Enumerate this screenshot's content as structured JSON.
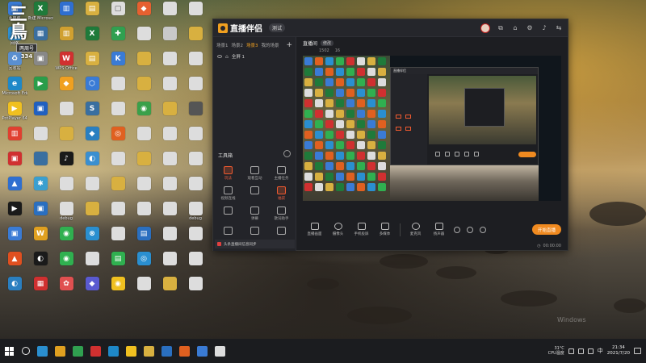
{
  "desktop_badge": {
    "big": "三鳥",
    "tag": "两周号",
    "num": "334"
  },
  "desktop_icons": [
    {
      "label": "此电脑",
      "color": "#3a7bd5",
      "g": "▣"
    },
    {
      "label": "新建 Microsoft",
      "color": "#1f7a3a",
      "g": "X"
    },
    {
      "label": "",
      "color": "#2f6fd0",
      "g": "▥"
    },
    {
      "label": "",
      "color": "#d8b040",
      "g": "▤"
    },
    {
      "label": "",
      "color": "#dddddd",
      "g": "▢"
    },
    {
      "label": "",
      "color": "#e66030",
      "g": "◆"
    },
    {
      "label": "",
      "color": "#dddddd",
      "g": ""
    },
    {
      "label": "",
      "color": "#dddddd",
      "g": ""
    },
    {
      "label": "网络",
      "color": "#2f8fd0",
      "g": "◉"
    },
    {
      "label": "",
      "color": "#3a6fa0",
      "g": "▦"
    },
    {
      "label": "",
      "color": "#d0a030",
      "g": "▥"
    },
    {
      "label": "",
      "color": "#1f7a3a",
      "g": "X"
    },
    {
      "label": "",
      "color": "#30a050",
      "g": "✚"
    },
    {
      "label": "",
      "color": "#dddddd",
      "g": ""
    },
    {
      "label": "",
      "color": "#c9c9c9",
      "g": ""
    },
    {
      "label": "",
      "color": "#d8b040",
      "g": ""
    },
    {
      "label": "回收站",
      "color": "#5a8fd0",
      "g": "♻"
    },
    {
      "label": "",
      "color": "#888888",
      "g": "▣"
    },
    {
      "label": "WPS Office",
      "color": "#d03030",
      "g": "W"
    },
    {
      "label": "",
      "color": "#d8b040",
      "g": "▤"
    },
    {
      "label": "",
      "color": "#3a7bd5",
      "g": "K"
    },
    {
      "label": "",
      "color": "#d8b040",
      "g": ""
    },
    {
      "label": "",
      "color": "#dddddd",
      "g": ""
    },
    {
      "label": "",
      "color": "#dddddd",
      "g": ""
    },
    {
      "label": "Microsoft Edge",
      "color": "#1e88c8",
      "g": "e"
    },
    {
      "label": "",
      "color": "#2a9d4a",
      "g": "▶"
    },
    {
      "label": "",
      "color": "#f0a020",
      "g": "◆"
    },
    {
      "label": "",
      "color": "#3a7bd5",
      "g": "⬡"
    },
    {
      "label": "",
      "color": "#dddddd",
      "g": ""
    },
    {
      "label": "",
      "color": "#d8b040",
      "g": ""
    },
    {
      "label": "",
      "color": "#dddddd",
      "g": ""
    },
    {
      "label": "",
      "color": "#dddddd",
      "g": ""
    },
    {
      "label": "PotPlayer 64 bit",
      "color": "#f0c020",
      "g": "▶"
    },
    {
      "label": "",
      "color": "#2060c0",
      "g": "▣"
    },
    {
      "label": "",
      "color": "#dddddd",
      "g": ""
    },
    {
      "label": "",
      "color": "#3a6fa0",
      "g": "S"
    },
    {
      "label": "",
      "color": "#dddddd",
      "g": ""
    },
    {
      "label": "",
      "color": "#3aa04a",
      "g": "◉"
    },
    {
      "label": "",
      "color": "#d8b040",
      "g": ""
    },
    {
      "label": "",
      "color": "#555555",
      "g": ""
    },
    {
      "label": "",
      "color": "#e04030",
      "g": "▥"
    },
    {
      "label": "",
      "color": "#dddddd",
      "g": ""
    },
    {
      "label": "",
      "color": "#d8b040",
      "g": ""
    },
    {
      "label": "",
      "color": "#2a7fc0",
      "g": "◆"
    },
    {
      "label": "",
      "color": "#e06020",
      "g": "◎"
    },
    {
      "label": "",
      "color": "#dddddd",
      "g": ""
    },
    {
      "label": "",
      "color": "#dddddd",
      "g": ""
    },
    {
      "label": "",
      "color": "#dddddd",
      "g": ""
    },
    {
      "label": "",
      "color": "#d03030",
      "g": "▣"
    },
    {
      "label": "",
      "color": "#3a6fa0",
      "g": ""
    },
    {
      "label": "",
      "color": "#1a1a1a",
      "g": "♪"
    },
    {
      "label": "",
      "color": "#3a8fd0",
      "g": "◐"
    },
    {
      "label": "",
      "color": "#dddddd",
      "g": ""
    },
    {
      "label": "",
      "color": "#d8b040",
      "g": ""
    },
    {
      "label": "",
      "color": "#dddddd",
      "g": ""
    },
    {
      "label": "",
      "color": "#dddddd",
      "g": ""
    },
    {
      "label": "",
      "color": "#2f6fd0",
      "g": "▲"
    },
    {
      "label": "",
      "color": "#3a9fd0",
      "g": "✱"
    },
    {
      "label": "",
      "color": "#dddddd",
      "g": ""
    },
    {
      "label": "",
      "color": "#dddddd",
      "g": ""
    },
    {
      "label": "",
      "color": "#d8b040",
      "g": ""
    },
    {
      "label": "",
      "color": "#dddddd",
      "g": ""
    },
    {
      "label": "",
      "color": "#dddddd",
      "g": ""
    },
    {
      "label": "",
      "color": "#dddddd",
      "g": ""
    },
    {
      "label": "",
      "color": "#1a1a1a",
      "g": "▶"
    },
    {
      "label": "",
      "color": "#2a6fc0",
      "g": "▣"
    },
    {
      "label": "debug",
      "color": "#dddddd",
      "g": ""
    },
    {
      "label": "",
      "color": "#d8b040",
      "g": ""
    },
    {
      "label": "",
      "color": "#dddddd",
      "g": ""
    },
    {
      "label": "",
      "color": "#dddddd",
      "g": ""
    },
    {
      "label": "",
      "color": "#dddddd",
      "g": ""
    },
    {
      "label": "debug",
      "color": "#dddddd",
      "g": ""
    },
    {
      "label": "",
      "color": "#3a7bd5",
      "g": "▣"
    },
    {
      "label": "",
      "color": "#e0a020",
      "g": "W"
    },
    {
      "label": "",
      "color": "#30b050",
      "g": "◉"
    },
    {
      "label": "",
      "color": "#2a8fd0",
      "g": "⊗"
    },
    {
      "label": "",
      "color": "#dddddd",
      "g": ""
    },
    {
      "label": "",
      "color": "#2a6fc0",
      "g": "▤"
    },
    {
      "label": "",
      "color": "#dddddd",
      "g": ""
    },
    {
      "label": "",
      "color": "#dddddd",
      "g": ""
    },
    {
      "label": "",
      "color": "#e05020",
      "g": "▲"
    },
    {
      "label": "",
      "color": "#1a1a1a",
      "g": "◐"
    },
    {
      "label": "",
      "color": "#30b050",
      "g": "◉"
    },
    {
      "label": "",
      "color": "#dddddd",
      "g": ""
    },
    {
      "label": "",
      "color": "#30b050",
      "g": "▤"
    },
    {
      "label": "",
      "color": "#2a8fd0",
      "g": "◎"
    },
    {
      "label": "",
      "color": "#dddddd",
      "g": ""
    },
    {
      "label": "",
      "color": "#dddddd",
      "g": ""
    },
    {
      "label": "",
      "color": "#2a7fc0",
      "g": "◐"
    },
    {
      "label": "",
      "color": "#d03030",
      "g": "▦"
    },
    {
      "label": "",
      "color": "#e05050",
      "g": "✿"
    },
    {
      "label": "",
      "color": "#5a5ad0",
      "g": "◆"
    },
    {
      "label": "",
      "color": "#f0c020",
      "g": "◉"
    },
    {
      "label": "",
      "color": "#dddddd",
      "g": ""
    },
    {
      "label": "",
      "color": "#d8b040",
      "g": ""
    },
    {
      "label": "",
      "color": "#dddddd",
      "g": ""
    }
  ],
  "app": {
    "brand": "直播伴侣",
    "version": "测试",
    "tabs": [
      "场景1",
      "场景2",
      "场景3",
      "我的场景"
    ],
    "active_tab_index": 2,
    "scene_item": "全屏 1",
    "toolbox_title": "工具箱",
    "tools": [
      {
        "label": "玩法",
        "hot": true
      },
      {
        "label": "观看互动",
        "hot": false
      },
      {
        "label": "主播任务",
        "hot": false
      },
      {
        "label": "视频连线",
        "hot": false
      },
      {
        "label": "",
        "hot": false
      },
      {
        "label": "福袋",
        "hot": true
      },
      {
        "label": "",
        "hot": false
      },
      {
        "label": "弹幕",
        "hot": false
      },
      {
        "label": "歌词助手",
        "hot": false
      },
      {
        "label": "",
        "hot": false
      },
      {
        "label": "",
        "hot": false
      },
      {
        "label": "",
        "hot": false
      }
    ],
    "bottom_notice": "头条直播间信息同步",
    "room_title": "直播间",
    "room_edit": "修改",
    "room_meta": {
      "category": "",
      "id": "",
      "fans": "1502",
      "viewers": "16"
    },
    "controls": [
      {
        "label": "直播画面",
        "round": false
      },
      {
        "label": "摄像头",
        "round": true
      },
      {
        "label": "手机投屏",
        "round": false
      },
      {
        "label": "多媒体",
        "round": false
      },
      {
        "label": "麦克风",
        "round": true
      },
      {
        "label": "扬声器",
        "round": false
      }
    ],
    "go_live": "开始直播",
    "status_time": "00:00:00"
  },
  "watermark": {
    "line1": "Windows",
    "line2": ""
  },
  "taskbar": {
    "icons": [
      "#2a8fd0",
      "#e0a020",
      "#30a050",
      "#d03030",
      "#1e88c8",
      "#f0c020",
      "#d8b040",
      "#2a6fc0",
      "#e06020",
      "#3a7bd5",
      "#dddddd"
    ],
    "weather_temp": "31°C",
    "weather_desc": "CPU温度",
    "ime": "中",
    "time": "21:34",
    "date": "2021/7/20"
  },
  "colors": {
    "accent": "#f08a20",
    "hot": "#f05a30",
    "window_bg": "#1d1e22"
  }
}
